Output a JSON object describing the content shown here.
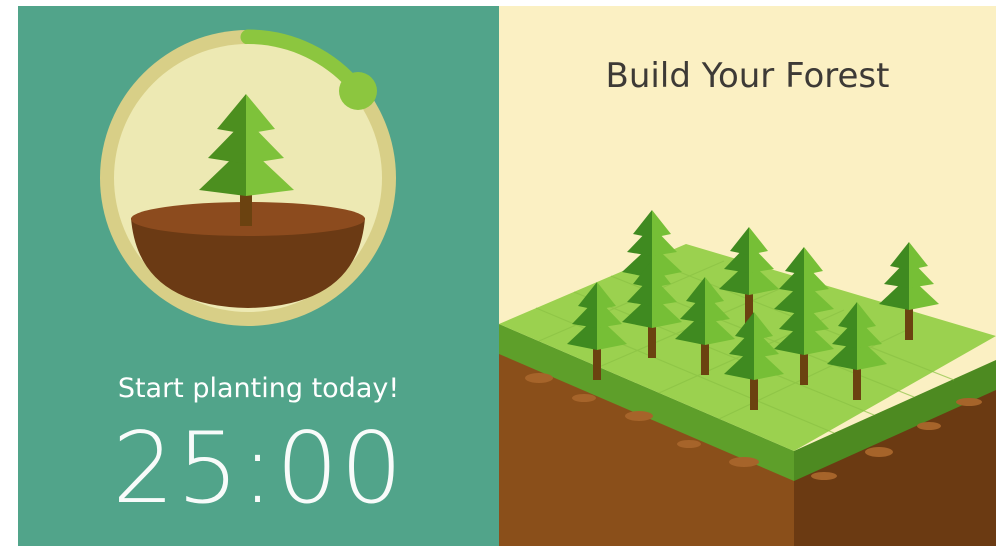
{
  "left": {
    "tagline": "Start planting today!",
    "timer": "25:00",
    "progress_fraction": 0.16,
    "background_color": "#51a48a"
  },
  "right": {
    "title": "Build Your Forest",
    "background_color": "#fbf0c3"
  },
  "icons": {
    "timer_tree": "pine-tree-icon",
    "forest_trees": "pine-tree-icon"
  }
}
